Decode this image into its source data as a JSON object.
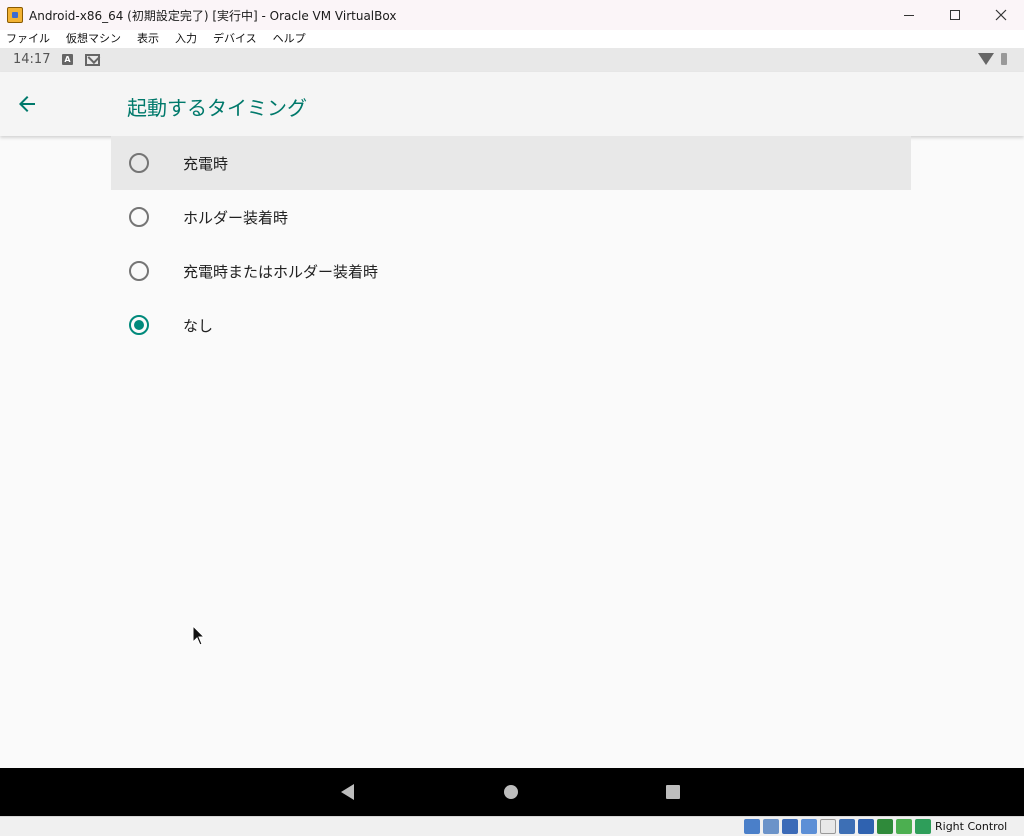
{
  "window": {
    "title": "Android-x86_64 (初期設定完了) [実行中] - Oracle VM VirtualBox",
    "icon": "virtualbox-icon"
  },
  "menubar": {
    "items": [
      "ファイル",
      "仮想マシン",
      "表示",
      "入力",
      "デバイス",
      "ヘルプ"
    ]
  },
  "statusbar": {
    "time": "14:17",
    "notification_a": "A",
    "icons": [
      "notification-a-icon",
      "gmail-icon",
      "wifi-icon",
      "battery-icon"
    ]
  },
  "appbar": {
    "title": "起動するタイミング",
    "back_icon": "arrow-back-icon"
  },
  "options": [
    {
      "label": "充電時",
      "checked": false,
      "highlighted": true
    },
    {
      "label": "ホルダー装着時",
      "checked": false,
      "highlighted": false
    },
    {
      "label": "充電時またはホルダー装着時",
      "checked": false,
      "highlighted": false
    },
    {
      "label": "なし",
      "checked": true,
      "highlighted": false
    }
  ],
  "navbar": {
    "icons": [
      "nav-back-icon",
      "nav-home-icon",
      "nav-recents-icon"
    ]
  },
  "vbox_status": {
    "host_key": "Right Control"
  },
  "colors": {
    "accent": "#00796b",
    "radio_checked": "#00897b",
    "radio_unchecked": "#757575"
  }
}
